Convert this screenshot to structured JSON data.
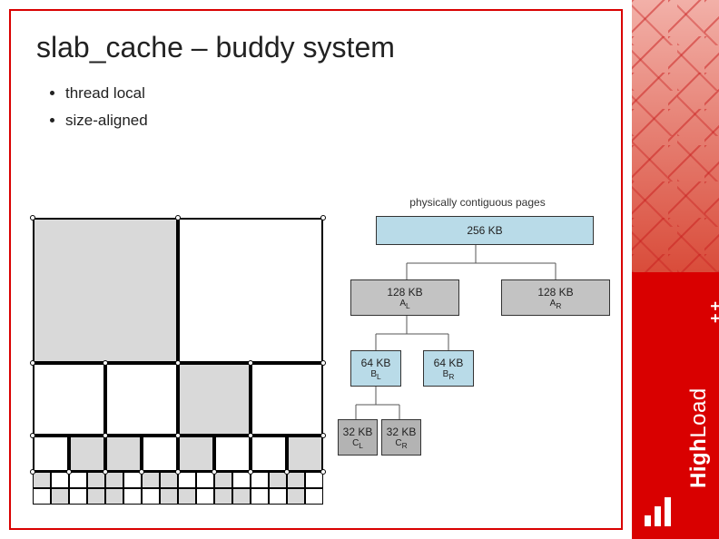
{
  "title": "slab_cache – buddy system",
  "bullets": [
    "thread local",
    "size-aligned"
  ],
  "legend": "physically contiguous pages",
  "tree": {
    "n256": "256 KB",
    "n128l_size": "128 KB",
    "n128l_sub": "A",
    "n128r_size": "128 KB",
    "n128r_sub": "A",
    "n64l_size": "64 KB",
    "n64l_sub": "B",
    "n64r_size": "64 KB",
    "n64r_sub": "B",
    "n32l_size": "32 KB",
    "n32l_sub": "C",
    "n32r_size": "32 KB",
    "n32r_sub": "C",
    "subL": "L",
    "subR": "R"
  },
  "colors": {
    "blue": "#b9dbe8",
    "gray": "#c3c3c3",
    "darkgray": "#b3b3b3"
  },
  "brand": {
    "name_bold": "High",
    "name_light": "Load",
    "suffix": "++"
  }
}
